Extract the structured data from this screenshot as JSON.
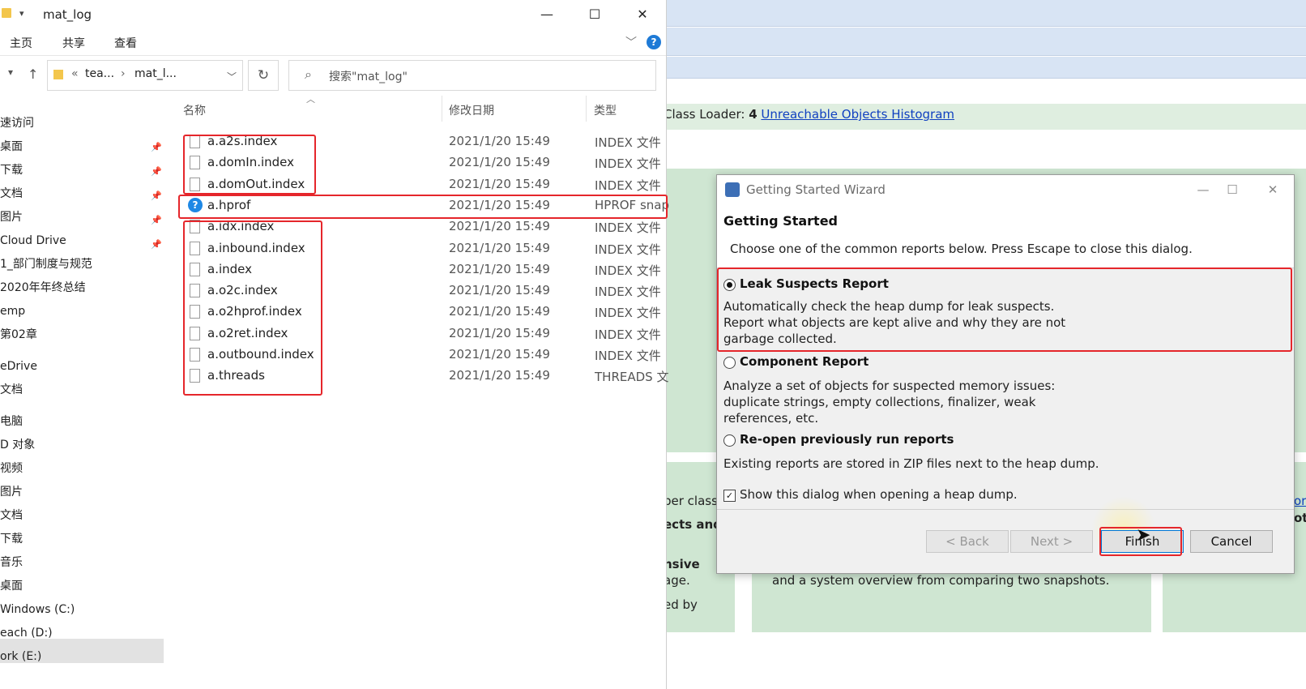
{
  "explorer": {
    "title": "mat_log",
    "window_controls": [
      "—",
      "☐",
      "✕"
    ],
    "ribbon_tabs": [
      "主页",
      "共享",
      "查看"
    ],
    "address": {
      "part1": "tea...",
      "part2": "mat_l...",
      "prefix": "«",
      "separator": "›"
    },
    "search_placeholder": "搜索\"mat_log\"",
    "columns": {
      "name": "名称",
      "date": "修改日期",
      "type": "类型"
    },
    "sidebar": [
      "速访问",
      "桌面",
      "下载",
      "文档",
      "图片",
      "Cloud Drive",
      "1_部门制度与规范",
      "2020年年终总结",
      "emp",
      "第02章",
      "eDrive",
      "文档",
      "电脑",
      "D 对象",
      "视频",
      "图片",
      "文档",
      "下载",
      "音乐",
      "桌面",
      "Windows (C:)",
      "each (D:)",
      "ork (E:)"
    ],
    "files": [
      {
        "name": "a.a2s.index",
        "date": "2021/1/20 15:49",
        "type": "INDEX 文件"
      },
      {
        "name": "a.domIn.index",
        "date": "2021/1/20 15:49",
        "type": "INDEX 文件"
      },
      {
        "name": "a.domOut.index",
        "date": "2021/1/20 15:49",
        "type": "INDEX 文件"
      },
      {
        "name": "a.hprof",
        "date": "2021/1/20 15:49",
        "type": "HPROF snap"
      },
      {
        "name": "a.idx.index",
        "date": "2021/1/20 15:49",
        "type": "INDEX 文件"
      },
      {
        "name": "a.inbound.index",
        "date": "2021/1/20 15:49",
        "type": "INDEX 文件"
      },
      {
        "name": "a.index",
        "date": "2021/1/20 15:49",
        "type": "INDEX 文件"
      },
      {
        "name": "a.o2c.index",
        "date": "2021/1/20 15:49",
        "type": "INDEX 文件"
      },
      {
        "name": "a.o2hprof.index",
        "date": "2021/1/20 15:49",
        "type": "INDEX 文件"
      },
      {
        "name": "a.o2ret.index",
        "date": "2021/1/20 15:49",
        "type": "INDEX 文件"
      },
      {
        "name": "a.outbound.index",
        "date": "2021/1/20 15:49",
        "type": "INDEX 文件"
      },
      {
        "name": "a.threads",
        "date": "2021/1/20 15:49",
        "type": "THREADS 文"
      }
    ]
  },
  "mat": {
    "classloader_label": "Class Loader:",
    "classloader_count": "4",
    "histogram_link": "Unreachable Objects Histogram",
    "frag1": "per class",
    "frag2": "ects and",
    "frag3": "nsive",
    "frag4": "age.",
    "frag5": "ed by",
    "frag6": "and a system overview from comparing two snapshots.",
    "frag7": "or",
    "frag8": "ot"
  },
  "dialog": {
    "title": "Getting Started Wizard",
    "heading": "Getting Started",
    "subtitle": "Choose one of the common reports below. Press Escape to close this dialog.",
    "options": [
      {
        "label": "Leak Suspects Report",
        "desc": "Automatically check the heap dump for leak suspects. Report what objects are kept alive and why they are not garbage collected.",
        "selected": true
      },
      {
        "label": "Component Report",
        "desc": "Analyze a set of objects for suspected memory issues: duplicate strings, empty collections, finalizer, weak references, etc.",
        "selected": false
      },
      {
        "label": "Re-open previously run reports",
        "desc": "Existing reports are stored in ZIP files next to the heap dump.",
        "selected": false
      }
    ],
    "checkbox_label": "Show this dialog when opening a heap dump.",
    "checkbox_checked": true,
    "buttons": {
      "back": "< Back",
      "next": "Next >",
      "finish": "Finish",
      "cancel": "Cancel"
    }
  },
  "colors": {
    "highlight_red": "#e5262b",
    "link_blue": "#1040c0",
    "mat_green": "#cfe6d2",
    "mat_blue": "#d8e4f4"
  }
}
